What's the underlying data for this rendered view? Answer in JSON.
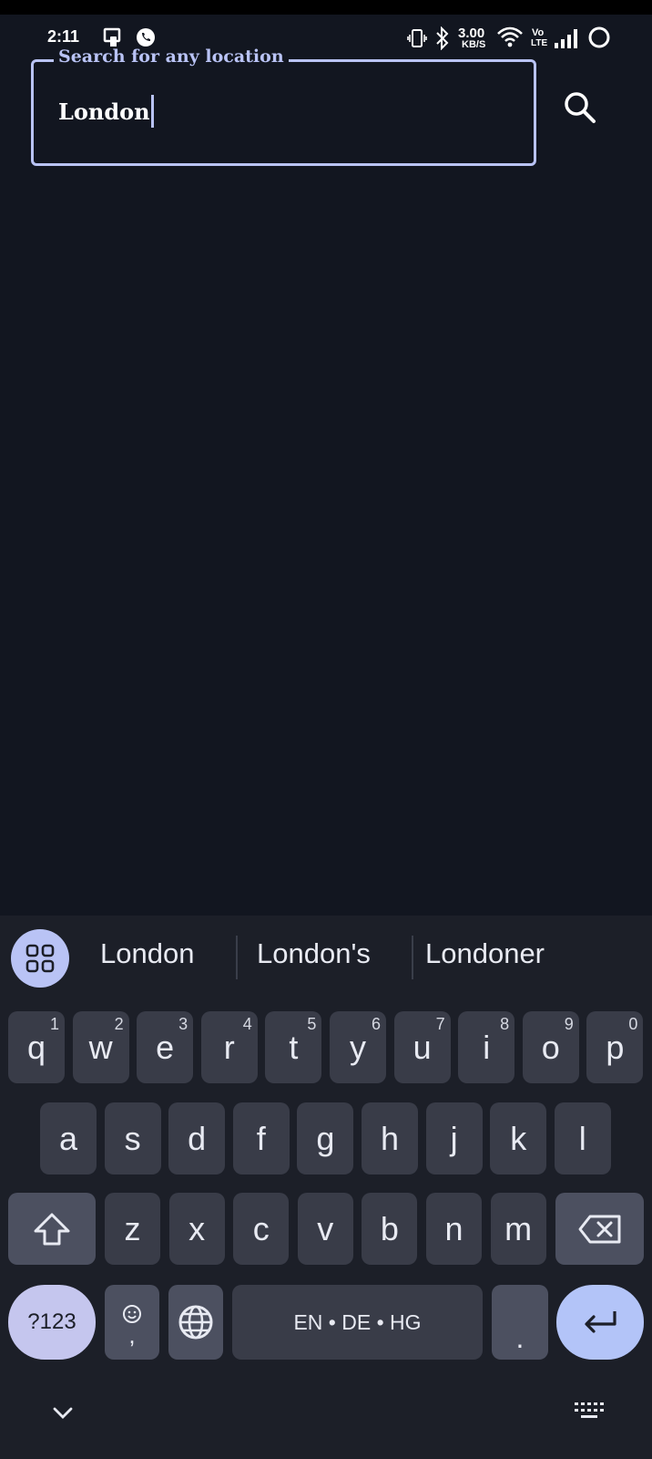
{
  "status_bar": {
    "time": "2:11",
    "net_speed_value": "3.00",
    "net_speed_unit": "KB/S",
    "volte_top": "Vo",
    "volte_bottom": "LTE",
    "icons": [
      "phone-icon",
      "whatsapp-icon",
      "vibrate-icon",
      "bluetooth-icon",
      "wifi-icon",
      "signal-icon",
      "battery-icon"
    ]
  },
  "search": {
    "label": "Search for any location",
    "value": "London",
    "button_icon": "search-icon"
  },
  "keyboard": {
    "suggestions": [
      "London",
      "London's",
      "Londoner"
    ],
    "row1": [
      {
        "k": "q",
        "h": "1"
      },
      {
        "k": "w",
        "h": "2"
      },
      {
        "k": "e",
        "h": "3"
      },
      {
        "k": "r",
        "h": "4"
      },
      {
        "k": "t",
        "h": "5"
      },
      {
        "k": "y",
        "h": "6"
      },
      {
        "k": "u",
        "h": "7"
      },
      {
        "k": "i",
        "h": "8"
      },
      {
        "k": "o",
        "h": "9"
      },
      {
        "k": "p",
        "h": "0"
      }
    ],
    "row2": [
      "a",
      "s",
      "d",
      "f",
      "g",
      "h",
      "j",
      "k",
      "l"
    ],
    "row3": [
      "z",
      "x",
      "c",
      "v",
      "b",
      "n",
      "m"
    ],
    "symbols_label": "?123",
    "comma_label": ",",
    "space_label": "EN • DE • HG",
    "period_label": ".",
    "accent_color": "#b9c3f5"
  }
}
